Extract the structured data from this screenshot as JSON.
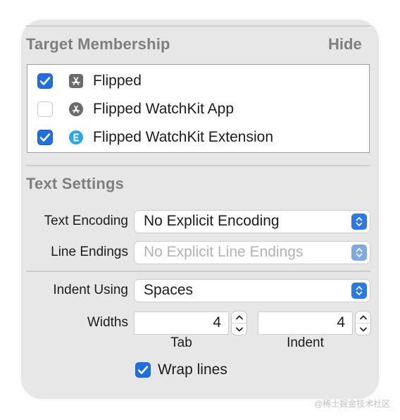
{
  "target_membership": {
    "title": "Target Membership",
    "hide_label": "Hide",
    "items": [
      {
        "label": "Flipped",
        "checked": true,
        "icon": "app-store-icon"
      },
      {
        "label": "Flipped WatchKit App",
        "checked": false,
        "icon": "app-store-icon"
      },
      {
        "label": "Flipped WatchKit Extension",
        "checked": true,
        "icon": "extension-icon"
      }
    ]
  },
  "text_settings": {
    "title": "Text Settings",
    "text_encoding": {
      "label": "Text Encoding",
      "value": "No Explicit Encoding"
    },
    "line_endings": {
      "label": "Line Endings",
      "value": "No Explicit Line Endings"
    },
    "indent_using": {
      "label": "Indent Using",
      "value": "Spaces"
    },
    "widths": {
      "label": "Widths",
      "tab": {
        "value": "4",
        "label": "Tab"
      },
      "indent": {
        "value": "4",
        "label": "Indent"
      }
    },
    "wrap_lines": {
      "label": "Wrap lines",
      "checked": true
    }
  },
  "watermark": "@稀土掘金技术社区",
  "colors": {
    "accent": "#1f6fe0",
    "panel_background": "#e7e7e7",
    "section_title": "#7f7f7f"
  }
}
